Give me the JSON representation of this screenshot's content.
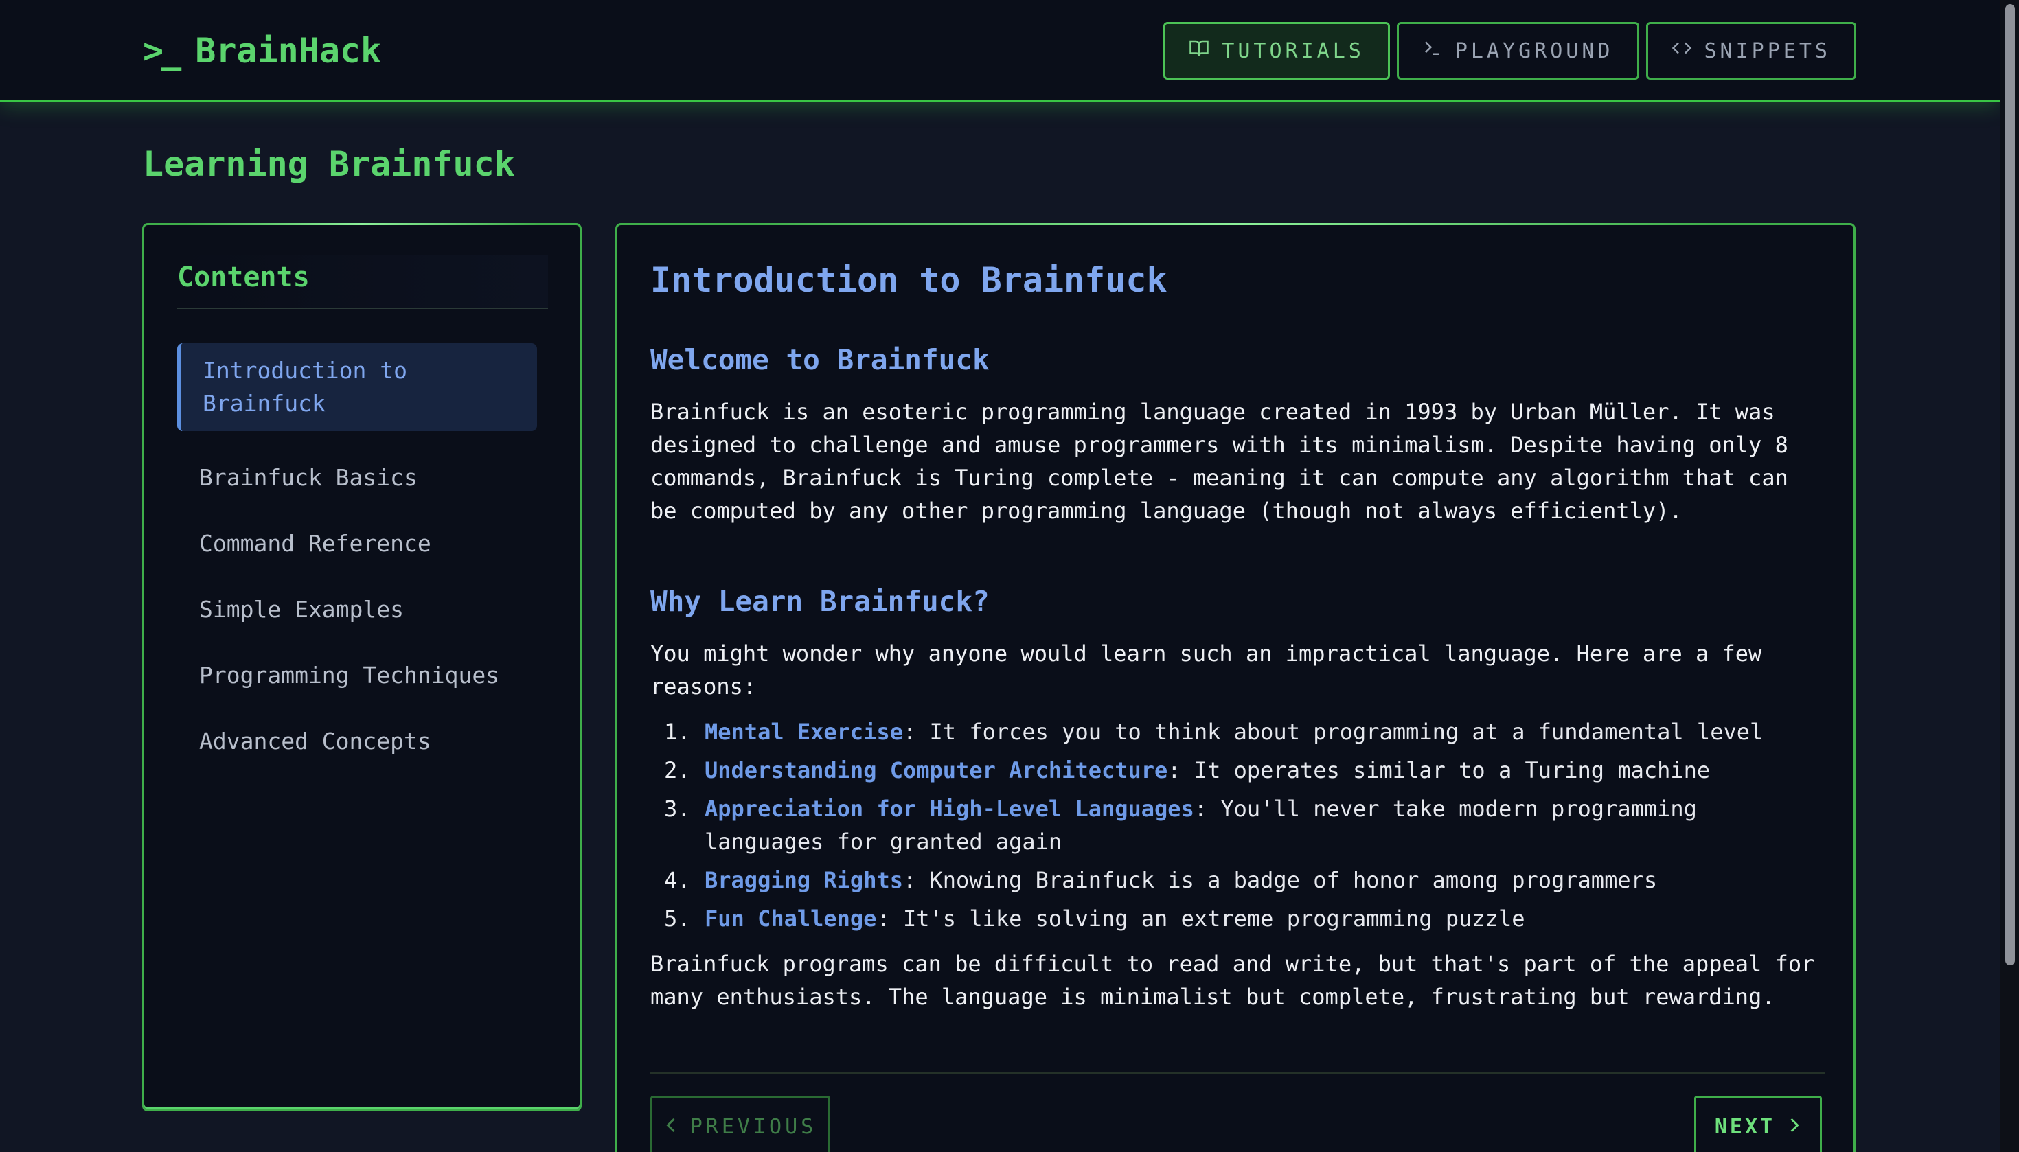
{
  "app": {
    "logo_prompt": ">_",
    "logo_name": "BrainHack"
  },
  "nav": {
    "tutorials": "TUTORIALS",
    "playground": "PLAYGROUND",
    "snippets": "SNIPPETS",
    "icons": {
      "tutorials": "book-icon",
      "playground": "terminal-icon",
      "snippets": "code-icon"
    },
    "active": "tutorials"
  },
  "page": {
    "title": "Learning Brainfuck"
  },
  "sidebar": {
    "heading": "Contents",
    "items": [
      {
        "label": "Introduction to Brainfuck",
        "active": true
      },
      {
        "label": "Brainfuck Basics"
      },
      {
        "label": "Command Reference"
      },
      {
        "label": "Simple Examples"
      },
      {
        "label": "Programming Techniques"
      },
      {
        "label": "Advanced Concepts"
      }
    ]
  },
  "article": {
    "title": "Introduction to Brainfuck",
    "section1_heading": "Welcome to Brainfuck",
    "section1_text": "Brainfuck is an esoteric programming language created in 1993 by Urban Müller. It was designed to challenge and amuse programmers with its minimalism. Despite having only 8 commands, Brainfuck is Turing complete - meaning it can compute any algorithm that can be computed by any other programming language (though not always efficiently).",
    "section2_heading": "Why Learn Brainfuck?",
    "section2_text": "You might wonder why anyone would learn such an impractical language. Here are a few reasons:",
    "reasons": [
      {
        "num": "1.",
        "term": "Mental Exercise",
        "text": ": It forces you to think about programming at a fundamental level"
      },
      {
        "num": "2.",
        "term": "Understanding Computer Architecture",
        "text": ": It operates similar to a Turing machine"
      },
      {
        "num": "3.",
        "term": "Appreciation for High-Level Languages",
        "text": ": You'll never take modern programming languages for granted again"
      },
      {
        "num": "4.",
        "term": "Bragging Rights",
        "text": ": Knowing Brainfuck is a badge of honor among programmers"
      },
      {
        "num": "5.",
        "term": "Fun Challenge",
        "text": ": It's like solving an extreme programming puzzle"
      }
    ],
    "closing_text": "Brainfuck programs can be difficult to read and write, but that's part of the appeal for many enthusiasts. The language is minimalist but complete, frustrating but rewarding."
  },
  "pager": {
    "prev_label": "PREVIOUS",
    "next_label": "NEXT"
  },
  "colors": {
    "accent_green": "#5bd46d",
    "accent_blue": "#7fa6ee",
    "background": "#111624",
    "panel": "#0a0e19"
  }
}
